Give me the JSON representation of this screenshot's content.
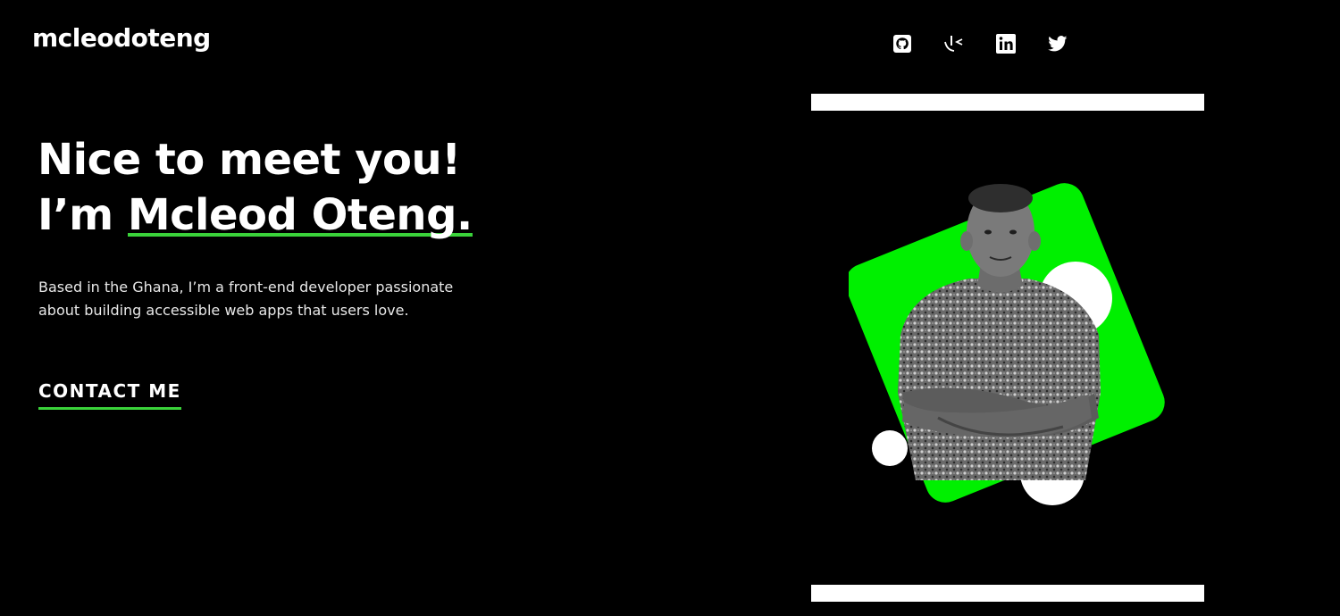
{
  "header": {
    "logo": "mcleodoteng",
    "social_links": [
      {
        "icon": "github-icon"
      },
      {
        "icon": "frontend-mentor-icon"
      },
      {
        "icon": "linkedin-icon"
      },
      {
        "icon": "twitter-icon"
      }
    ]
  },
  "hero": {
    "greeting": "Nice to meet you!",
    "intro_prefix": "I’m ",
    "name": "Mcleod Oteng.",
    "description": "Based in the Ghana, I’m a front-end developer passionate about building accessible web apps that users love.",
    "cta_label": "CONTACT ME"
  },
  "colors": {
    "background": "#000000",
    "text": "#ffffff",
    "accent": "#3ad33a",
    "green_shape": "#00f000"
  }
}
